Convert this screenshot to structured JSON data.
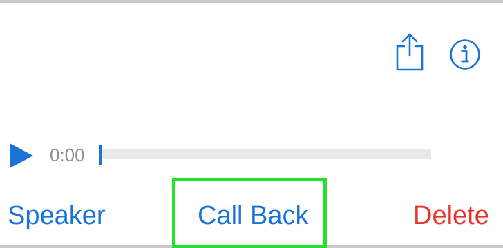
{
  "header": {
    "share_icon": "share-icon",
    "info_icon": "info-icon"
  },
  "player": {
    "play_icon": "play-icon",
    "time": "0:00",
    "progress": 0
  },
  "actions": {
    "speaker_label": "Speaker",
    "call_back_label": "Call Back",
    "delete_label": "Delete"
  },
  "colors": {
    "accent": "#1a73d6",
    "destructive": "#e8322a",
    "highlight": "#22e22a",
    "secondary_text": "#8e8e93",
    "track": "#e9e9ea"
  }
}
